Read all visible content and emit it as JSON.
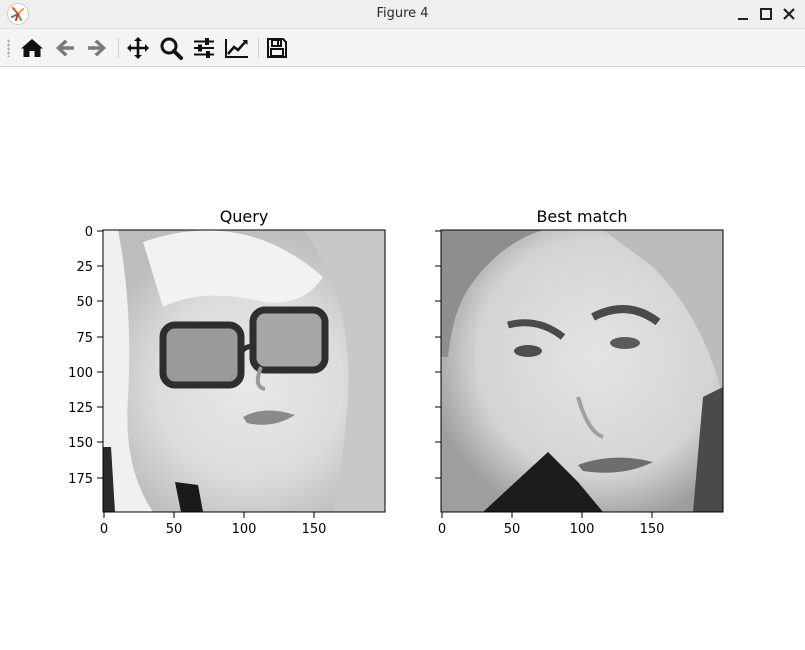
{
  "window": {
    "title": "Figure 4",
    "app_icon": "matplotlib-icon",
    "controls": [
      "minimize-icon",
      "maximize-icon",
      "close-icon"
    ]
  },
  "toolbar": {
    "tools": [
      {
        "name": "home-icon",
        "tooltip": "Reset original view"
      },
      {
        "name": "back-arrow-icon",
        "tooltip": "Back to previous view"
      },
      {
        "name": "forward-arrow-icon",
        "tooltip": "Forward to next view"
      },
      {
        "name": "pan-icon",
        "tooltip": "Pan axes"
      },
      {
        "name": "zoom-icon",
        "tooltip": "Zoom to rectangle"
      },
      {
        "name": "configure-subplots-icon",
        "tooltip": "Configure subplots"
      },
      {
        "name": "edit-axis-icon",
        "tooltip": "Edit axis"
      },
      {
        "name": "save-icon",
        "tooltip": "Save the figure"
      }
    ]
  },
  "figure": {
    "panels": [
      {
        "title": "Query",
        "xticks": [
          "0",
          "50",
          "100",
          "150"
        ],
        "yticks": [
          "0",
          "25",
          "50",
          "75",
          "100",
          "125",
          "150",
          "175"
        ],
        "image": "grayscale face photo, person with blonde hair and dark-framed glasses",
        "xlim": [
          0,
          200
        ],
        "ylim": [
          200,
          0
        ]
      },
      {
        "title": "Best match",
        "xticks": [
          "0",
          "50",
          "100",
          "150"
        ],
        "image": "grayscale face photo, person with dark hair looking sideways",
        "xlim": [
          0,
          200
        ],
        "ylim": [
          200,
          0
        ]
      }
    ]
  }
}
